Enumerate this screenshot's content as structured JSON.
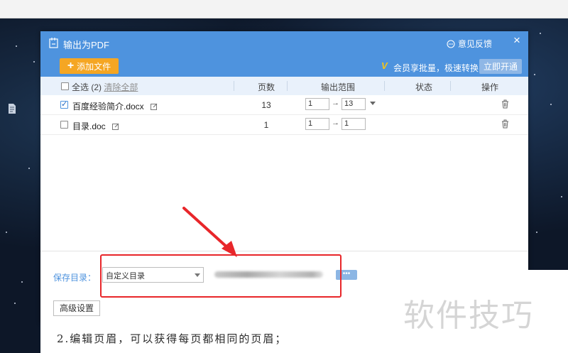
{
  "dialog": {
    "title": "输出为PDF",
    "feedback": "意见反馈",
    "close": "×",
    "add_file": "添加文件",
    "vip_icon": "V",
    "vip_text": "会员享批量，极速转换",
    "open_now": "立即开通"
  },
  "table": {
    "select_all": "全选",
    "count": "(2)",
    "clear_all": "清除全部",
    "headers": {
      "pages": "页数",
      "range": "输出范围",
      "status": "状态",
      "action": "操作"
    },
    "arrow_glyph": "→",
    "rows": [
      {
        "name": "百度经验简介.docx",
        "checked": true,
        "pages": "13",
        "from": "1",
        "to": "13"
      },
      {
        "name": "目录.doc",
        "checked": false,
        "pages": "1",
        "from": "1",
        "to": "1"
      }
    ]
  },
  "footer": {
    "save_dir_label": "保存目录：",
    "save_dir_value": "自定义目录",
    "more": "•••",
    "advanced": "高级设置"
  },
  "caption": "2.编辑页眉，可以获得每页都相同的页眉；",
  "watermark": "软件技巧",
  "colors": {
    "accent": "#4e93de",
    "orange": "#f5a623",
    "highlight": "#e8262a"
  }
}
